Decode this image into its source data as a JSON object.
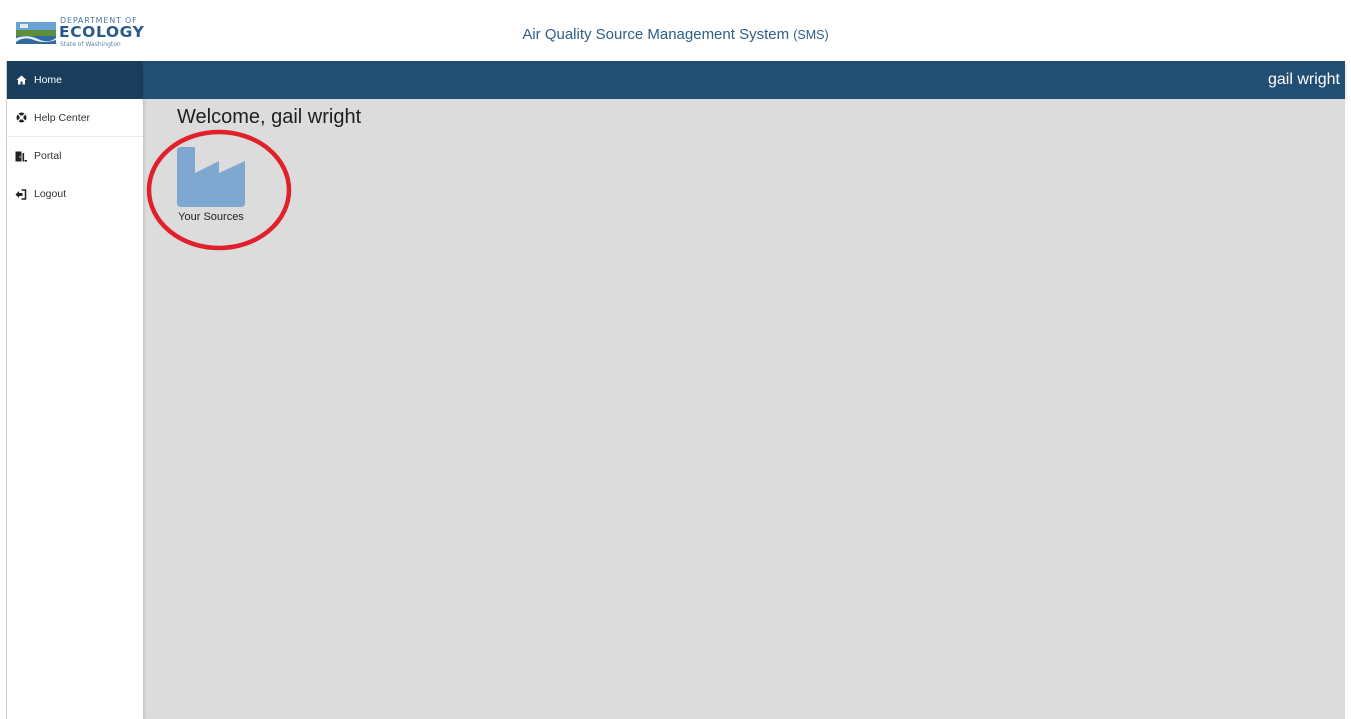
{
  "logo": {
    "line1": "DEPARTMENT OF",
    "line2": "ECOLOGY",
    "line3": "State of Washington"
  },
  "app": {
    "title": "Air Quality Source Management System",
    "abbr": "(SMS)"
  },
  "user": {
    "name": "gail wright"
  },
  "sidebar": {
    "items": [
      {
        "label": "Home",
        "icon": "home-icon",
        "active": true
      },
      {
        "label": "Help Center",
        "icon": "life-ring-icon",
        "active": false
      },
      {
        "label": "Portal",
        "icon": "portal-icon",
        "active": false
      },
      {
        "label": "Logout",
        "icon": "logout-icon",
        "active": false
      }
    ]
  },
  "main": {
    "welcome": "Welcome, gail wright",
    "tiles": [
      {
        "label": "Your Sources",
        "icon": "factory-icon"
      }
    ]
  },
  "colors": {
    "header_bar": "#234e73",
    "active_nav": "#1b3d5c",
    "content_bg": "#dcdcdc",
    "tile_icon": "#7fa8d0",
    "annotation": "#e0202a"
  }
}
